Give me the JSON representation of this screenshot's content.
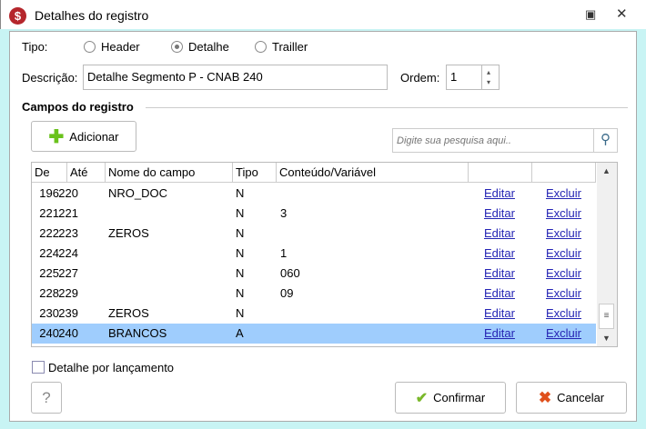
{
  "window": {
    "title": "Detalhes do registro",
    "icon": "dollar-icon"
  },
  "tipo": {
    "label": "Tipo:",
    "options": [
      {
        "label": "Header",
        "selected": false
      },
      {
        "label": "Detalhe",
        "selected": true
      },
      {
        "label": "Trailler",
        "selected": false
      }
    ]
  },
  "descricao": {
    "label": "Descrição:",
    "value": "Detalhe Segmento P - CNAB 240"
  },
  "ordem": {
    "label": "Ordem:",
    "value": "1"
  },
  "section": {
    "title": "Campos do registro"
  },
  "adicionar_label": "Adicionar",
  "search": {
    "placeholder": "Digite sua pesquisa aqui.."
  },
  "grid": {
    "columns": [
      "De",
      "Até",
      "Nome do campo",
      "Tipo",
      "Conteúdo/Variável",
      "",
      ""
    ],
    "rows": [
      {
        "de": "196",
        "ate": "220",
        "nome": "NRO_DOC",
        "tipo": "N",
        "conteudo": "",
        "editar": "Editar",
        "excluir": "Excluir"
      },
      {
        "de": "221",
        "ate": "221",
        "nome": "",
        "tipo": "N",
        "conteudo": "3",
        "editar": "Editar",
        "excluir": "Excluir"
      },
      {
        "de": "222",
        "ate": "223",
        "nome": "ZEROS",
        "tipo": "N",
        "conteudo": "",
        "editar": "Editar",
        "excluir": "Excluir"
      },
      {
        "de": "224",
        "ate": "224",
        "nome": "",
        "tipo": "N",
        "conteudo": "1",
        "editar": "Editar",
        "excluir": "Excluir"
      },
      {
        "de": "225",
        "ate": "227",
        "nome": "",
        "tipo": "N",
        "conteudo": "060",
        "editar": "Editar",
        "excluir": "Excluir"
      },
      {
        "de": "228",
        "ate": "229",
        "nome": "",
        "tipo": "N",
        "conteudo": "09",
        "editar": "Editar",
        "excluir": "Excluir"
      },
      {
        "de": "230",
        "ate": "239",
        "nome": "ZEROS",
        "tipo": "N",
        "conteudo": "",
        "editar": "Editar",
        "excluir": "Excluir"
      },
      {
        "de": "240",
        "ate": "240",
        "nome": "BRANCOS",
        "tipo": "A",
        "conteudo": "",
        "editar": "Editar",
        "excluir": "Excluir",
        "selected": true
      }
    ]
  },
  "detalhe_por_lancamento": {
    "label": "Detalhe por lançamento",
    "checked": false
  },
  "help_label": "?",
  "confirmar_label": "Confirmar",
  "cancelar_label": "Cancelar"
}
